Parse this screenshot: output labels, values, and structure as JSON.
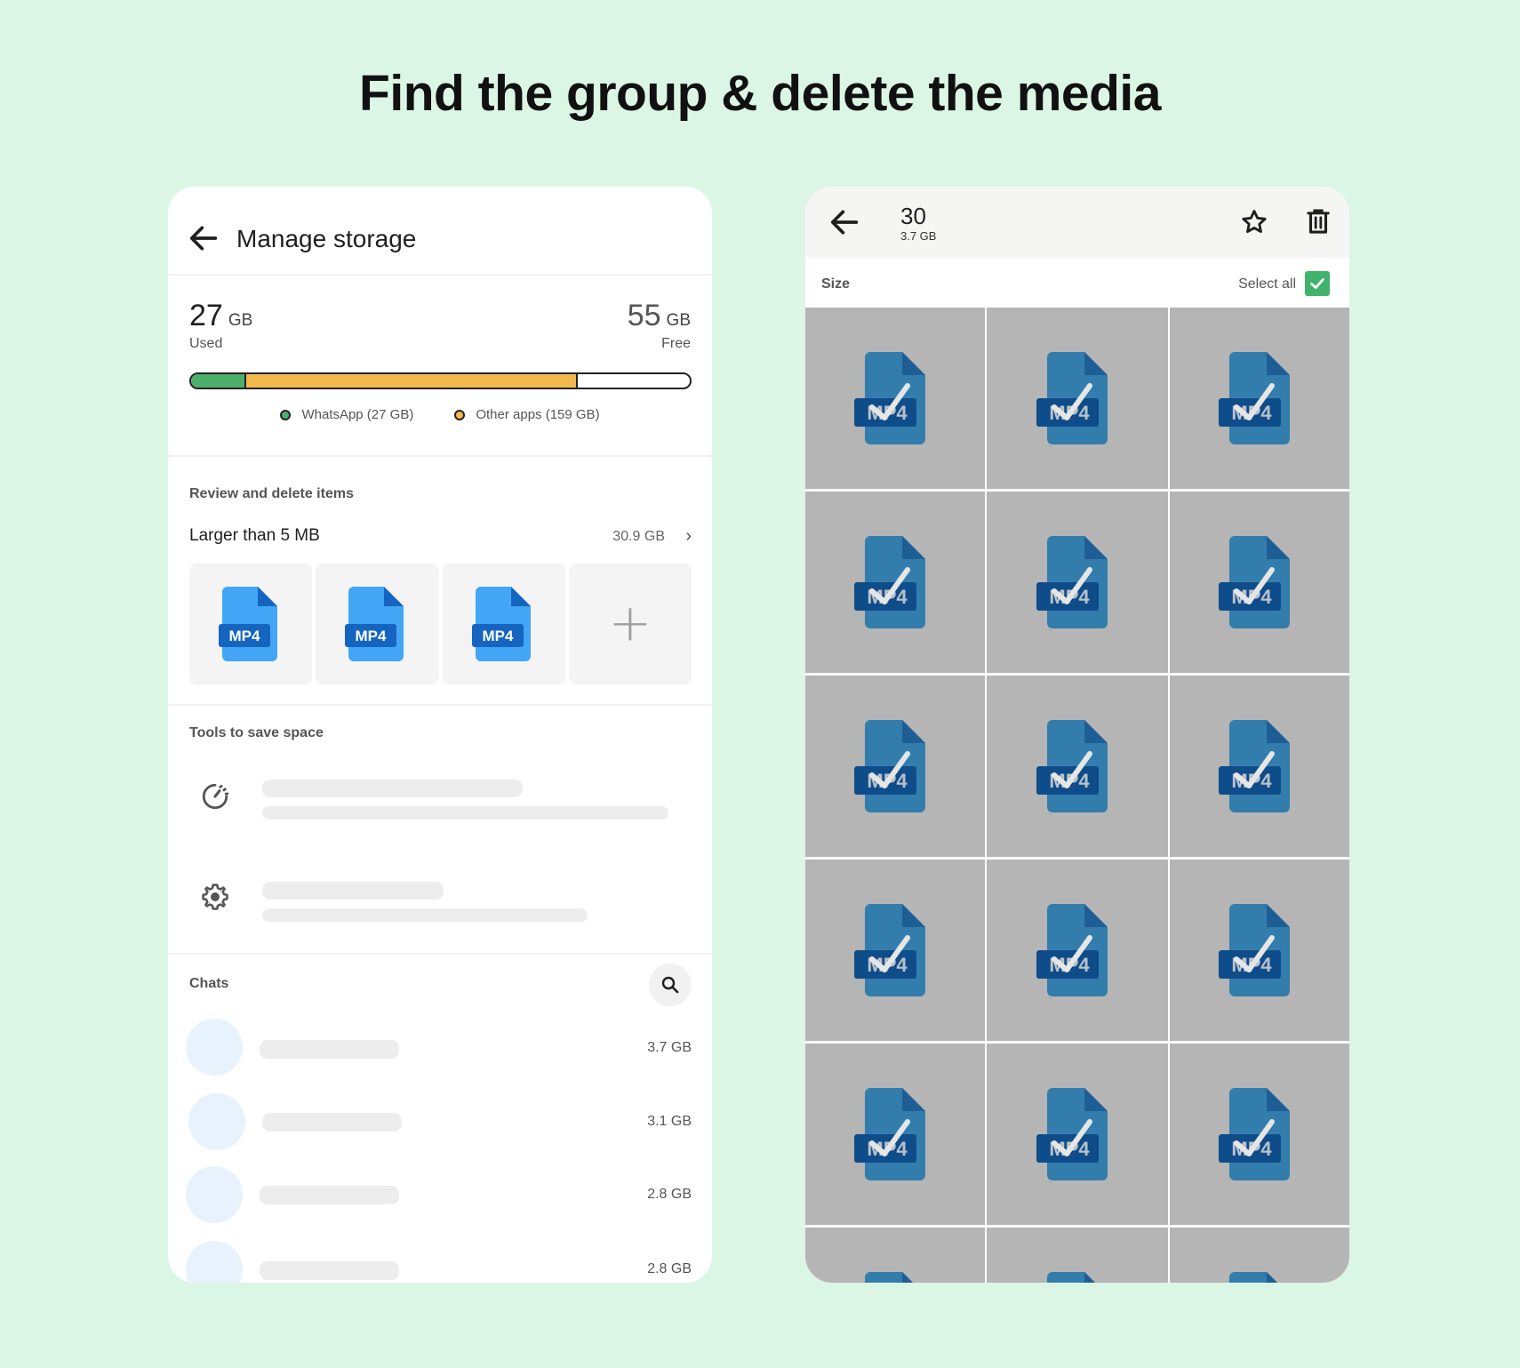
{
  "headline": "Find the group & delete the media",
  "manage": {
    "title": "Manage storage",
    "used_value": "27",
    "used_unit": "GB",
    "used_label": "Used",
    "free_value": "55",
    "free_unit": "GB",
    "free_label": "Free",
    "legend": [
      {
        "label": "WhatsApp (27 GB)",
        "color": "#4caf6a"
      },
      {
        "label": "Other apps (159 GB)",
        "color": "#f4b94c"
      }
    ],
    "review_heading": "Review and delete items",
    "larger_label": "Larger than 5 MB",
    "larger_size": "30.9 GB",
    "thumbs": [
      "MP4",
      "MP4",
      "MP4"
    ],
    "tools_heading": "Tools to save space",
    "tools": [
      {
        "icon": "speed-icon"
      },
      {
        "icon": "gear-icon"
      }
    ],
    "chats_heading": "Chats",
    "chats": [
      {
        "size": "3.7 GB"
      },
      {
        "size": "3.1 GB"
      },
      {
        "size": "2.8 GB"
      },
      {
        "size": "2.8 GB"
      }
    ]
  },
  "selection": {
    "count": "30",
    "size": "3.7 GB",
    "sort_label": "Size",
    "select_all_label": "Select all",
    "select_all_checked": true,
    "file_label": "MP4"
  },
  "colors": {
    "background": "#dcf6e5",
    "whatsapp": "#4caf6a",
    "other_apps": "#f4b94c",
    "select_check": "#3fb36a"
  }
}
